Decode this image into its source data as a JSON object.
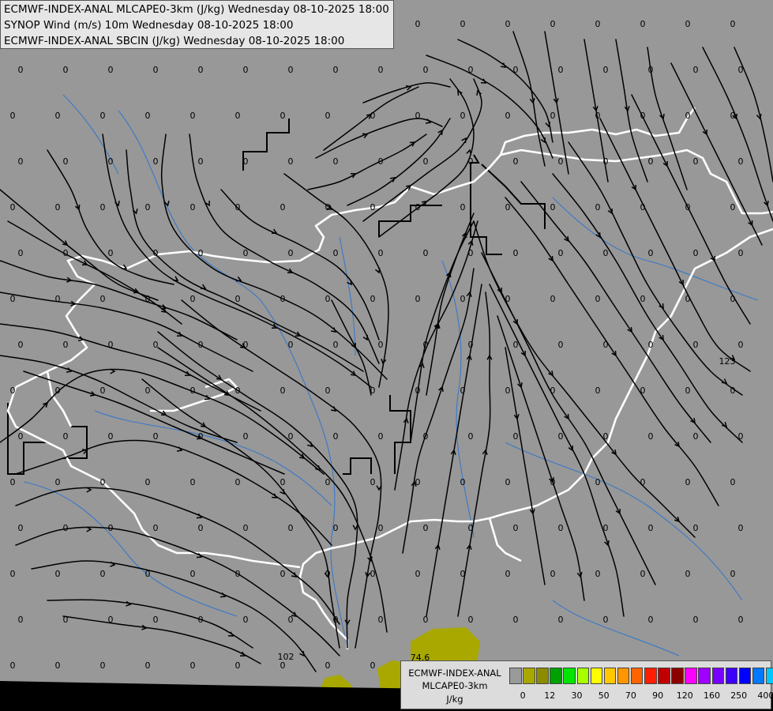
{
  "header": {
    "line1": "ECMWF-INDEX-ANAL MLCAPE0-3km (J/kg) Wednesday 08-10-2025 18:00",
    "line2": "SYNOP Wind (m/s) 10m Wednesday 08-10-2025 18:00",
    "line3": "ECMWF-INDEX-ANAL SBCIN (J/kg) Wednesday 08-10-2025 18:00"
  },
  "legend": {
    "title1": "ECMWF-INDEX-ANAL",
    "title2": "MLCAPE0-3km",
    "unit": "J/kg",
    "colors": [
      "#9a9a9a",
      "#a8a800",
      "#8c8c00",
      "#00a000",
      "#00e600",
      "#a8ff00",
      "#ffff00",
      "#ffc800",
      "#ff9600",
      "#ff6400",
      "#ff1e00",
      "#c00000",
      "#8c0000",
      "#ff00ff",
      "#a000ff",
      "#7800ff",
      "#3c00ff",
      "#0000ff",
      "#0078ff",
      "#00c8ff",
      "#00ffff",
      "#a0ffff",
      "#ffffff"
    ],
    "ticks": [
      "0",
      "12",
      "30",
      "50",
      "70",
      "90",
      "120",
      "160",
      "250",
      "400"
    ]
  },
  "map": {
    "background_color": "#989898",
    "cape_fill_color": "#a8a800",
    "border_color": "#ffffff",
    "river_color": "#3a78c8",
    "streamline_color": "#000000",
    "cape_label": "74.6",
    "cin_labels": [
      "123",
      "102"
    ],
    "zero_label": "0"
  }
}
